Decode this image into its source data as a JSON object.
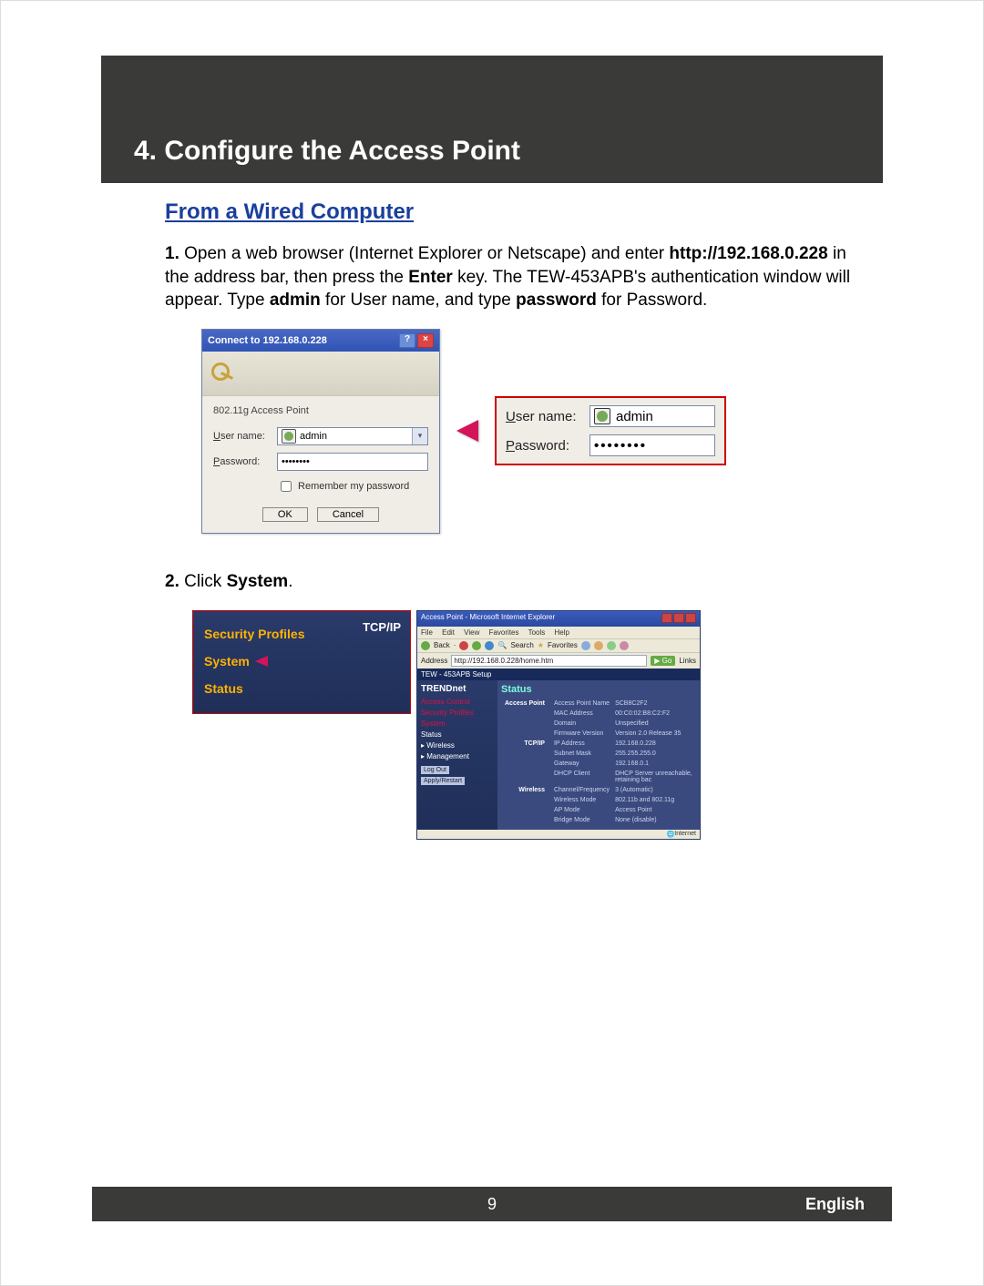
{
  "banner": {
    "title": "4. Configure the Access Point"
  },
  "section1": {
    "subhead": "From a Wired Computer",
    "step1_num": "1.",
    "step1_a": " Open a web browser (Internet Explorer or Netscape) and enter ",
    "step1_url": "http://192.168.0.228",
    "step1_b": " in the address bar, then press the ",
    "step1_enter": "Enter",
    "step1_c": " key. The TEW-453APB's authentication window will appear.  Type ",
    "step1_admin": "admin",
    "step1_d": " for User name, and type ",
    "step1_pw": "password",
    "step1_e": " for Password."
  },
  "dialog": {
    "title": "Connect to 192.168.0.228",
    "realm": "802.11g Access Point",
    "user_label_pre": "U",
    "user_label_post": "ser name:",
    "user_value": "admin",
    "pass_label_pre": "P",
    "pass_label_post": "assword:",
    "pass_value": "••••••••",
    "remember_pre": "R",
    "remember_post": "emember my password",
    "ok": "OK",
    "cancel": "Cancel"
  },
  "callout": {
    "user_label_pre": "U",
    "user_label_post": "ser name:",
    "user_value": "admin",
    "pass_label_pre": "P",
    "pass_label_post": "assword:",
    "pass_value": "••••••••"
  },
  "section2": {
    "step2_num": "2.",
    "step2_a": " Click ",
    "step2_sys": "System",
    "step2_b": "."
  },
  "sidebar": {
    "items": [
      "Security Profiles",
      "System",
      "Status"
    ],
    "tcpip": "TCP/IP"
  },
  "browser": {
    "title": "Access Point - Microsoft Internet Explorer",
    "menus": [
      "File",
      "Edit",
      "View",
      "Favorites",
      "Tools",
      "Help"
    ],
    "toolbar": {
      "back": "Back",
      "search": "Search",
      "fav": "Favorites"
    },
    "addr_label": "Address",
    "url": "http://192.168.0.228/home.htm",
    "go": "Go",
    "links": "Links",
    "bluebar": "TEW - 453APB Setup",
    "brand": "TRENDnet",
    "side_items": [
      "Access Control",
      "Security Profiles",
      "System",
      "Status",
      "▸ Wireless",
      "▸ Management"
    ],
    "logout": "Log Out",
    "apply": "Apply/Restart",
    "status_head": "Status",
    "ap_section": "Access Point",
    "ap_rows": [
      [
        "Access Point Name",
        "SCB8C2F2"
      ],
      [
        "MAC Address",
        "00:C0:02:B8:C2:F2"
      ],
      [
        "Domain",
        "Unspecified"
      ],
      [
        "Firmware Version",
        "Version 2.0 Release 35"
      ]
    ],
    "tcp_section": "TCP/IP",
    "tcp_rows": [
      [
        "IP Address",
        "192.168.0.228"
      ],
      [
        "Subnet Mask",
        "255.255.255.0"
      ],
      [
        "Gateway",
        "192.168.0.1"
      ],
      [
        "DHCP Client",
        "DHCP Server unreachable, retaining bac"
      ]
    ],
    "wl_section": "Wireless",
    "wl_rows": [
      [
        "Channel/Frequency",
        "3 (Automatic)"
      ],
      [
        "Wireless Mode",
        "802.11b and 802.11g"
      ],
      [
        "AP Mode",
        "Access Point"
      ],
      [
        "Bridge Mode",
        "None (disable)"
      ]
    ],
    "internet": "Internet"
  },
  "footer": {
    "page": "9",
    "lang": "English"
  }
}
